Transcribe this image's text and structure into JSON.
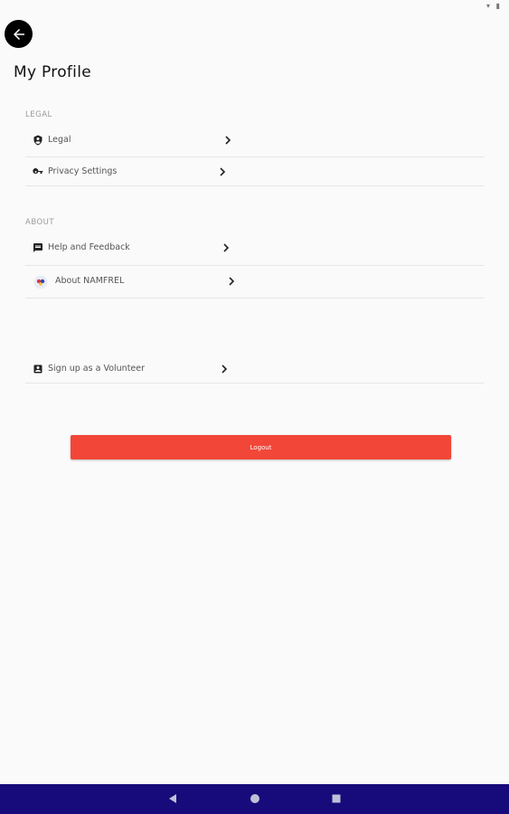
{
  "status_bar": {
    "icons": "▾ ▮"
  },
  "header": {
    "back_icon": "arrow-left-icon",
    "title": "My Profile"
  },
  "sections": {
    "legal": {
      "header": "LEGAL",
      "items": [
        {
          "label": "Legal",
          "icon": "shield-icon"
        },
        {
          "label": "Privacy Settings",
          "icon": "key-icon"
        }
      ]
    },
    "about": {
      "header": "ABOUT",
      "items": [
        {
          "label": "Help and Feedback",
          "icon": "message-icon"
        },
        {
          "label": "About NAMFREL",
          "icon": "namfrel-logo-icon"
        }
      ]
    },
    "volunteer": {
      "items": [
        {
          "label": "Sign up as a Volunteer",
          "icon": "contact-card-icon"
        }
      ]
    }
  },
  "logout": {
    "label": "Logout",
    "color": "#f24638"
  },
  "nav_bar": {
    "color": "#170a7a",
    "buttons": [
      "back-triangle-icon",
      "home-circle-icon",
      "recents-square-icon"
    ]
  }
}
